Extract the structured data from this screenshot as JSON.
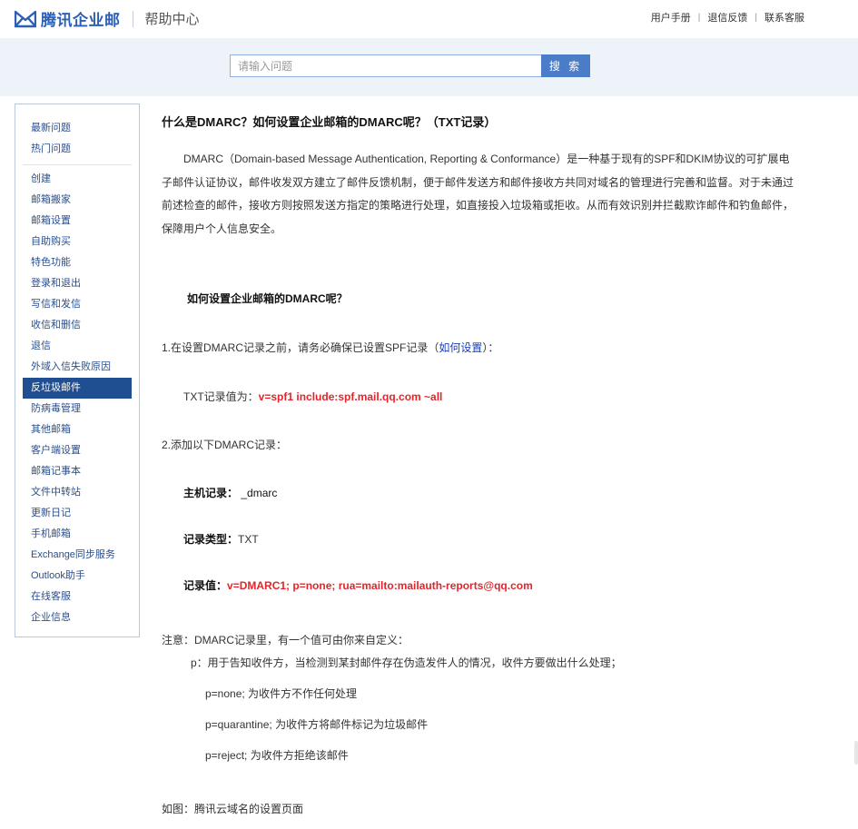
{
  "header": {
    "brand": "腾讯企业邮",
    "section": "帮助中心",
    "links": [
      "用户手册",
      "退信反馈",
      "联系客服"
    ]
  },
  "search": {
    "placeholder": "请输入问题",
    "value": "",
    "button_label": "搜 索"
  },
  "sidebar": {
    "group1": [
      "最新问题",
      "热门问题"
    ],
    "group2": [
      "创建",
      "邮箱搬家",
      "邮箱设置",
      "自助购买",
      "特色功能",
      "登录和退出",
      "写信和发信",
      "收信和删信",
      "退信",
      "外域入信失败原因",
      "反垃圾邮件",
      "防病毒管理",
      "其他邮箱",
      "客户端设置",
      "邮箱记事本",
      "文件中转站",
      "更新日记",
      "手机邮箱",
      "Exchange同步服务",
      "Outlook助手",
      "在线客服",
      "企业信息"
    ],
    "active": "反垃圾邮件"
  },
  "article": {
    "title": "什么是DMARC？如何设置企业邮箱的DMARC呢？（TXT记录）",
    "intro": "DMARC（Domain-based Message Authentication, Reporting & Conformance）是一种基于现有的SPF和DKIM协议的可扩展电子邮件认证协议，邮件收发双方建立了邮件反馈机制，便于邮件发送方和邮件接收方共同对域名的管理进行完善和监督。对于未通过前述检查的邮件，接收方则按照发送方指定的策略进行处理，如直接投入垃圾箱或拒收。从而有效识别并拦截欺诈邮件和钓鱼邮件，保障用户个人信息安全。",
    "subheading": "如何设置企业邮箱的DMARC呢？",
    "step1_prefix": "1.在设置DMARC记录之前，请务必确保已设置SPF记录（",
    "step1_link": "如何设置",
    "step1_suffix": "）：",
    "txt_label": "TXT记录值为：",
    "txt_value": "v=spf1 include:spf.mail.qq.com ~all",
    "step2": "2.添加以下DMARC记录：",
    "host_label": "主机记录：",
    "host_value": "_dmarc",
    "type_label": "记录类型：",
    "type_value": "TXT",
    "value_label": "记录值：",
    "value_value": "v=DMARC1; p=none; rua=mailto:mailauth-reports@qq.com",
    "note": "注意：DMARC记录里，有一个值可由你来自定义：",
    "p_desc": "p：用于告知收件方，当检测到某封邮件存在伪造发件人的情况，收件方要做出什么处理；",
    "p_none": "p=none;  为收件方不作任何处理",
    "p_quarantine": "p=quarantine; 为收件方将邮件标记为垃圾邮件",
    "p_reject": "p=reject; 为收件方拒绝该邮件",
    "figure_caption": "如图：腾讯云域名的设置页面"
  },
  "colors": {
    "brand_blue": "#2b5fb5",
    "active_nav": "#204f91",
    "highlight_red": "#e3242b",
    "link_blue": "#1a3fb8"
  }
}
